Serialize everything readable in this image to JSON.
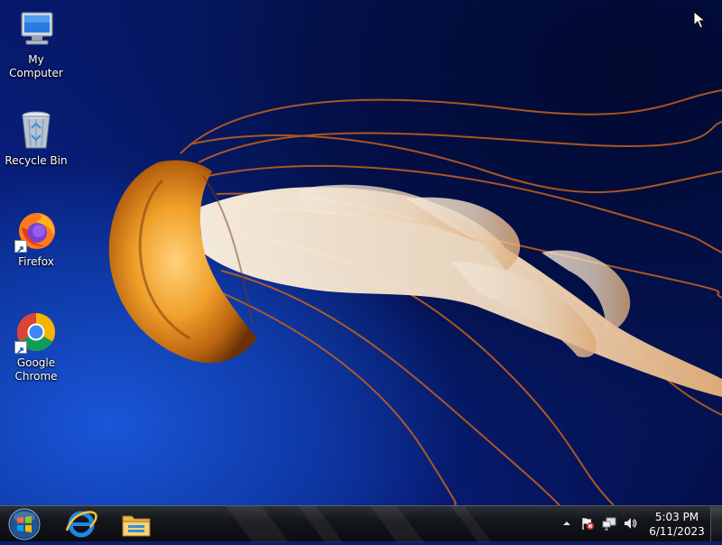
{
  "desktop": {
    "icons": [
      {
        "label": "My Computer",
        "icon": "computer-icon"
      },
      {
        "label": "Recycle Bin",
        "icon": "recycle-bin-icon"
      },
      {
        "label": "Firefox",
        "icon": "firefox-icon"
      },
      {
        "label": "Google\nChrome",
        "icon": "chrome-icon"
      }
    ]
  },
  "taskbar": {
    "start": {
      "icon": "windows-orb-icon"
    },
    "pinned": [
      {
        "icon": "internet-explorer-icon"
      },
      {
        "icon": "file-explorer-icon"
      }
    ],
    "tray": {
      "icons": [
        "show-hidden-icons-chevron",
        "action-center-flag-icon",
        "network-icon",
        "volume-icon"
      ],
      "time": "5:03 PM",
      "date": "6/11/2023"
    }
  },
  "colors": {
    "wallpaper_blue": "#0b2a9a",
    "jellyfish_orange": "#e8901c",
    "taskbar": "#14161b"
  }
}
